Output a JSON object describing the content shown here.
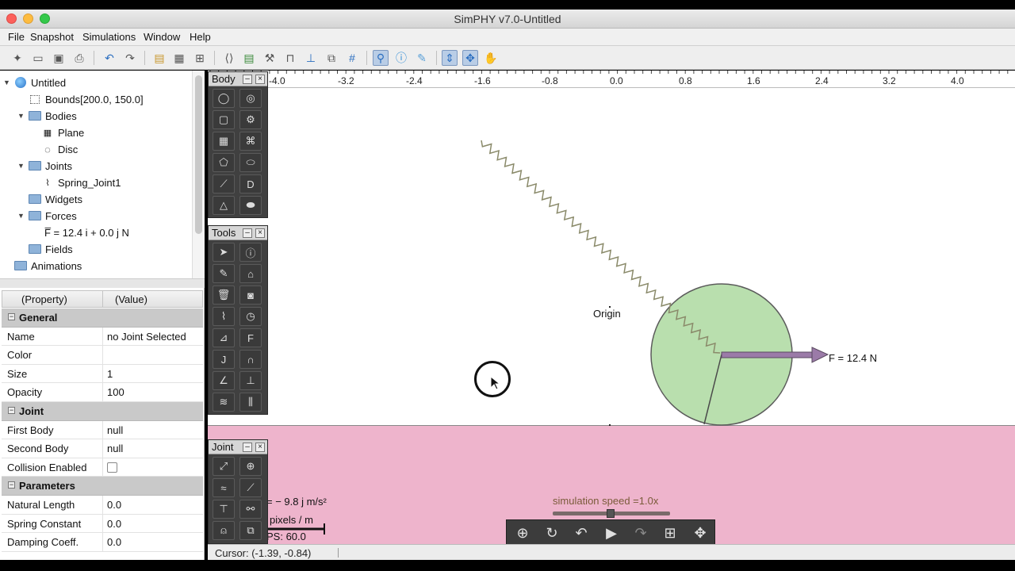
{
  "window": {
    "title": "SimPHY v7.0-Untitled"
  },
  "menu": [
    "File",
    "Snapshot",
    "Simulations",
    "Window",
    "Help"
  ],
  "tree": {
    "root": "Untitled",
    "bounds": "Bounds[200.0, 150.0]",
    "bodies_label": "Bodies",
    "bodies": [
      "Plane",
      "Disc"
    ],
    "joints_label": "Joints",
    "joints": [
      "Spring_Joint1"
    ],
    "widgets_label": "Widgets",
    "forces_label": "Forces",
    "forces": [
      "F̅  = 12.4 i + 0.0 j N"
    ],
    "fields_label": "Fields",
    "animations_label": "Animations"
  },
  "properties": {
    "col_property": "(Property)",
    "col_value": "(Value)",
    "rows": [
      {
        "section": true,
        "key": "General"
      },
      {
        "key": "Name",
        "value": "no Joint Selected"
      },
      {
        "key": "Color",
        "value": ""
      },
      {
        "key": "Size",
        "value": "1"
      },
      {
        "key": "Opacity",
        "value": "100"
      },
      {
        "section": true,
        "key": "Joint"
      },
      {
        "key": "First Body",
        "value": "null"
      },
      {
        "key": "Second Body",
        "value": "null"
      },
      {
        "key": "Collision Enabled",
        "value": "",
        "checkbox": true,
        "checked": false
      },
      {
        "section": true,
        "key": "Parameters"
      },
      {
        "key": "Natural Length",
        "value": "0.0"
      },
      {
        "key": "Spring Constant",
        "value": "0.0"
      },
      {
        "key": "Damping Coeff.",
        "value": "0.0"
      }
    ]
  },
  "ruler": [
    "-4.0",
    "-3.2",
    "-2.4",
    "-1.6",
    "-0.8",
    "0.0",
    "0.8",
    "1.6",
    "2.4",
    "3.2",
    "4.0"
  ],
  "palettes": {
    "body": "Body",
    "tools": "Tools",
    "joint": "Joint"
  },
  "scene": {
    "origin_label": "Origin",
    "force_label": "F = 12.4 N",
    "gravity_label": "= − 9.8 j m/s²",
    "scale_label": "pixels / m",
    "fps_label": "PS: 60.0",
    "speed_label": "simulation speed =1.0x",
    "speed": 1.0,
    "colors": {
      "ground": "#eeb4cc",
      "disc": "#b9dfae",
      "force_arrow": "#9b7ba8",
      "spring": "#8a8a6a"
    }
  },
  "status": {
    "cursor": "Cursor: (-1.39, -0.84)"
  }
}
